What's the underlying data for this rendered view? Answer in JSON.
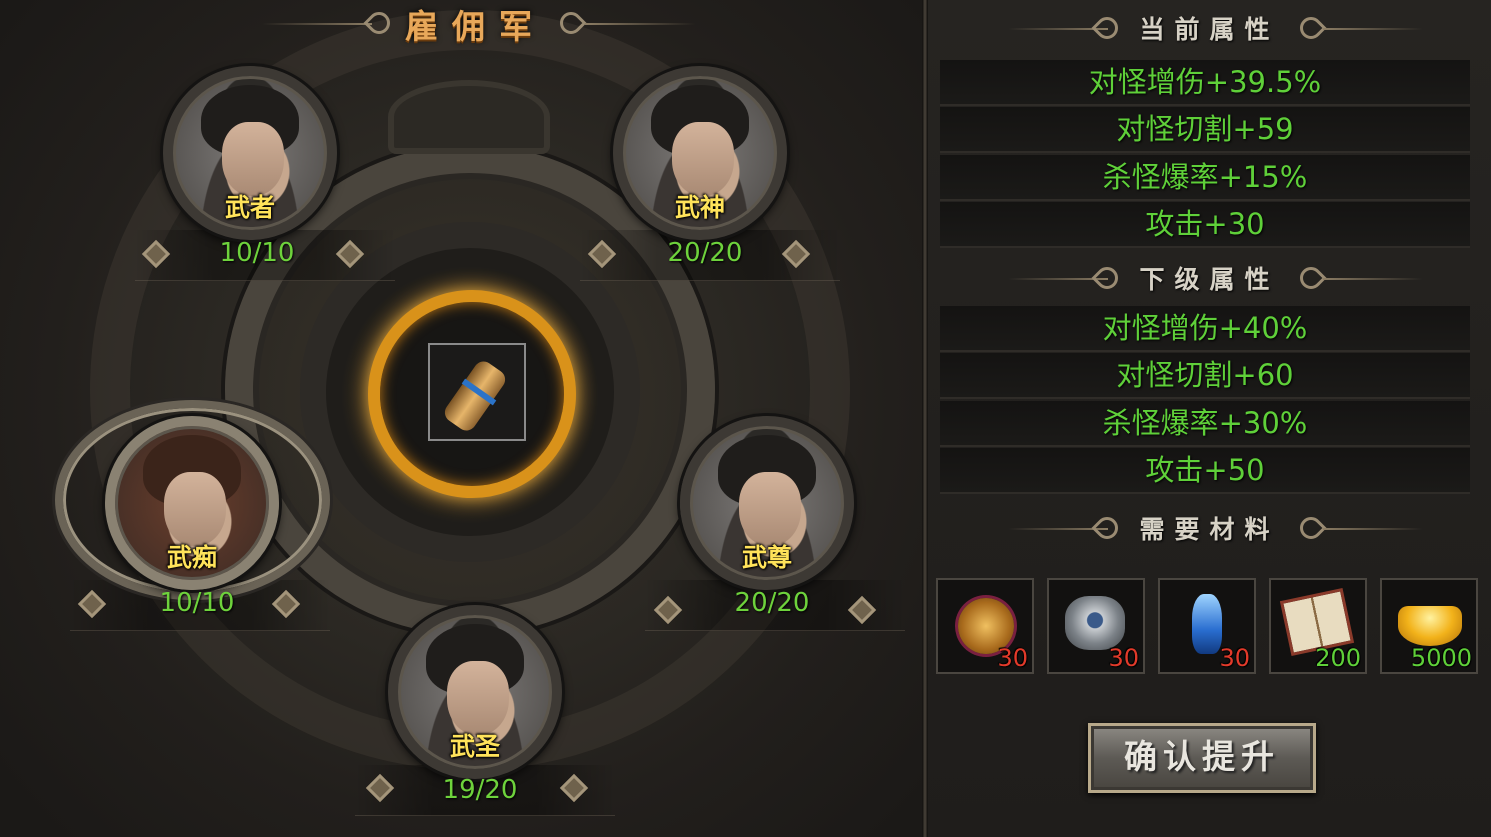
{
  "window": {
    "title": "雇佣军"
  },
  "mercenaries": [
    {
      "name": "武者",
      "level": "10/10"
    },
    {
      "name": "武神",
      "level": "20/20"
    },
    {
      "name": "武痴",
      "level": "10/10"
    },
    {
      "name": "武尊",
      "level": "20/20"
    },
    {
      "name": "武圣",
      "level": "19/20"
    }
  ],
  "center_item": {
    "icon": "scroll-icon"
  },
  "current_attributes": {
    "title": "当前属性",
    "items": [
      "对怪增伤+39.5%",
      "对怪切割+59",
      "杀怪爆率+15%",
      "攻击+30"
    ]
  },
  "next_attributes": {
    "title": "下级属性",
    "items": [
      "对怪增伤+40%",
      "对怪切割+60",
      "杀怪爆率+30%",
      "攻击+50"
    ]
  },
  "materials": {
    "title": "需要材料",
    "items": [
      {
        "icon": "gold-medal-icon",
        "count": "30",
        "count_color": "#e23a2a"
      },
      {
        "icon": "silver-ring-icon",
        "count": "30",
        "count_color": "#e23a2a"
      },
      {
        "icon": "blue-crystal-icon",
        "count": "30",
        "count_color": "#e23a2a"
      },
      {
        "icon": "book-icon",
        "count": "200",
        "count_color": "#5fd039"
      },
      {
        "icon": "gold-ingot-icon",
        "count": "5000",
        "count_color": "#5fd039"
      }
    ]
  },
  "confirm_button": {
    "label": "确认提升"
  },
  "colors": {
    "title_gold": "#e8a85a",
    "level_green": "#6ed23c",
    "name_yellow": "#ffe35a",
    "missing_red": "#e23a2a",
    "center_ring_gold": "#d9921a"
  }
}
